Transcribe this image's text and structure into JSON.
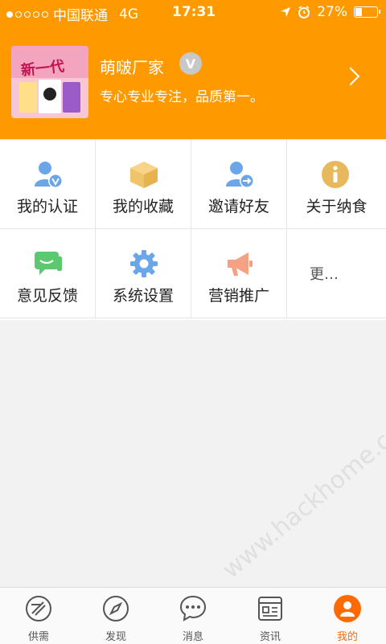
{
  "status": {
    "carrier": "中国联通",
    "network": "4G",
    "time": "17:31",
    "battery": "27%",
    "signal_dots_filled": 1,
    "signal_dots_total": 5
  },
  "profile": {
    "name": "萌啵厂家",
    "verified_badge": "V",
    "slogan": "专心专业专注，品质第一。",
    "avatar_text": "新一代"
  },
  "menu": {
    "row1": [
      {
        "label": "我的认证",
        "icon": "verified-user-icon",
        "color": "#6aa6e8"
      },
      {
        "label": "我的收藏",
        "icon": "box-icon",
        "color": "#f0c468"
      },
      {
        "label": "邀请好友",
        "icon": "invite-user-icon",
        "color": "#6aa6e8"
      },
      {
        "label": "关于纳食",
        "icon": "info-icon",
        "color": "#e8b85c"
      }
    ],
    "row2": [
      {
        "label": "意见反馈",
        "icon": "feedback-chat-icon",
        "color": "#5cc870"
      },
      {
        "label": "系统设置",
        "icon": "gear-icon",
        "color": "#6aa6e8"
      },
      {
        "label": "营销推广",
        "icon": "megaphone-icon",
        "color": "#f4a184"
      },
      {
        "label": "更…",
        "icon": "",
        "color": ""
      }
    ]
  },
  "tabs": [
    {
      "label": "供需",
      "icon": "supply-icon"
    },
    {
      "label": "发现",
      "icon": "compass-icon"
    },
    {
      "label": "消息",
      "icon": "message-icon"
    },
    {
      "label": "资讯",
      "icon": "news-icon"
    },
    {
      "label": "我的",
      "icon": "person-icon"
    }
  ],
  "active_tab": "我的",
  "colors": {
    "brand": "#ff9900",
    "active_tab": "#ff6a00",
    "background": "#f2f2f2"
  }
}
